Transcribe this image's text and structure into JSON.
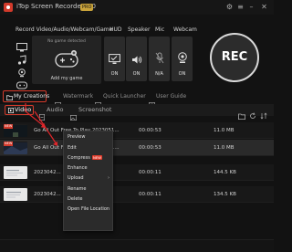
{
  "window": {
    "title": "iTop Screen Recorder 3.0",
    "badge": "PRO"
  },
  "capture_labels": {
    "source": "Record Video/Audio/Webcam/Game",
    "hud": "HUD",
    "speaker": "Speaker",
    "mic": "Mic",
    "webcam": "Webcam"
  },
  "game_preview": {
    "no_game": "No game detected",
    "add_game": "Add my game"
  },
  "toggles": {
    "hud": "ON",
    "speaker": "ON",
    "mic": "N/A",
    "webcam": "ON"
  },
  "rec_label": "REC",
  "nav": {
    "my_creations": "My Creations",
    "watermark": "Watermark",
    "quick_launcher": "Quick Launcher",
    "user_guide": "User Guide"
  },
  "tabs": {
    "video": "Video",
    "audio": "Audio",
    "screenshot": "Screenshot"
  },
  "files": [
    {
      "name": "Go All Out Free To Play 2023051...",
      "duration": "00:00:53",
      "size": "11.0 MB"
    },
    {
      "name": "Go All Out Free To Play 2023051...",
      "duration": "00:00:53",
      "size": "11.0 MB"
    },
    {
      "name": "2023042...",
      "duration": "00:00:11",
      "size": "144.5 KB"
    },
    {
      "name": "2023042...",
      "duration": "00:00:11",
      "size": "134.5 KB"
    }
  ],
  "context_menu": {
    "items": [
      "Preview",
      "Edit",
      "Compress",
      "Enhance",
      "Upload",
      "Rename",
      "Delete",
      "Open File Location"
    ],
    "compress_badge": "NEW"
  },
  "colors": {
    "accent": "#d63a2b",
    "background": "#121212"
  }
}
